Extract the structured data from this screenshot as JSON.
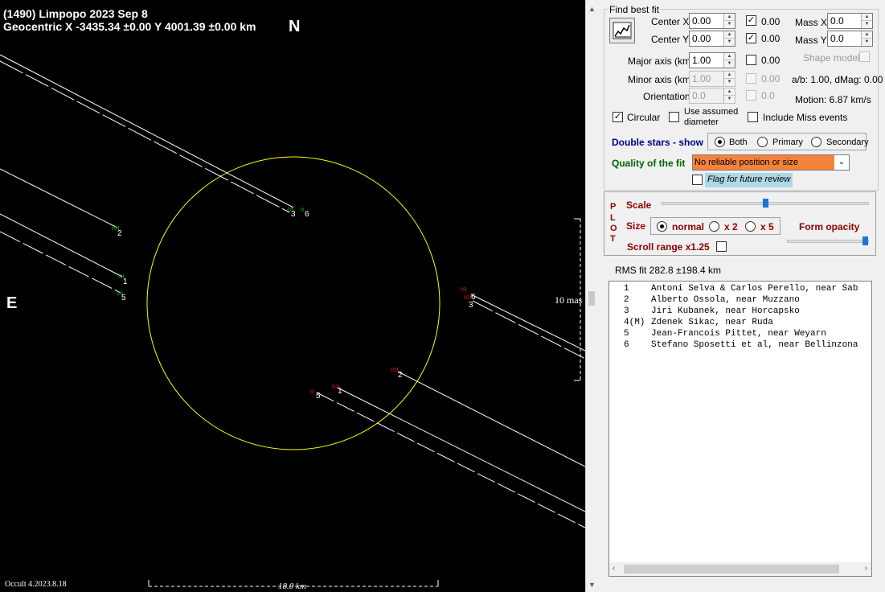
{
  "plot": {
    "title": "(1490) Limpopo  2023 Sep 8",
    "coords": "Geocentric X  -3435.34 ±0.00  Y 4001.39 ±0.00 km",
    "north": "N",
    "east": "E",
    "scale_mas": "10 mas",
    "scale_km": "18.0 km",
    "version": "Occult 4.2023.8.18",
    "chord_labels": [
      "2",
      "1",
      "5",
      "3",
      "6",
      "3",
      "6",
      "1",
      "5",
      "2"
    ]
  },
  "panel": {
    "find_best_fit": "Find best fit",
    "center_x_label": "Center X",
    "center_x_value": "0.00",
    "center_y_label": "Center Y",
    "center_y_value": "0.00",
    "center_x_unc": "0.00",
    "center_y_unc": "0.00",
    "mass_x_label": "Mass X",
    "mass_x_value": "0.0",
    "mass_y_label": "Mass Y",
    "mass_y_value": "0.0",
    "major_label": "Major axis (km)",
    "major_value": "1.00",
    "major_unc": "0.00",
    "minor_label": "Minor axis (km)",
    "minor_value": "1.00",
    "minor_unc": "0.00",
    "orient_label": "Orientation",
    "orient_value": "0.0",
    "orient_unc": "0.0",
    "shape_model": "Shape model",
    "ab_dmag": "a/b: 1.00, dMag: 0.00",
    "motion": "Motion: 6.87 km/s",
    "circular": "Circular",
    "use_assumed": "Use assumed",
    "diameter": "diameter",
    "include_miss": "Include Miss events",
    "double_stars": "Double stars - show",
    "both": "Both",
    "primary": "Primary",
    "secondary": "Secondary",
    "quality_label": "Quality of the fit",
    "quality_value": "No reliable position or size",
    "flag_review": "Flag for future review",
    "plot_letters": [
      "P",
      "L",
      "O",
      "T"
    ],
    "scale": "Scale",
    "size": "Size",
    "normal": "normal",
    "x2": "x 2",
    "x5": "x 5",
    "form_opacity": "Form opacity",
    "scroll_range": "Scroll range x1.25",
    "rms": "RMS fit 282.8 ±198.4 km"
  },
  "observers": [
    {
      "num": "1",
      "name": "Antoni Selva & Carlos Perello, near Sab"
    },
    {
      "num": "2",
      "name": "Alberto Ossola, near Muzzano"
    },
    {
      "num": "3",
      "name": "Jiri Kubanek, near Horcapsko"
    },
    {
      "num": "4(M)",
      "name": "Zdenek Sikac, near Ruda"
    },
    {
      "num": "5",
      "name": "Jean-Francois Pittet, near Weyarn"
    },
    {
      "num": "6",
      "name": "Stefano Sposetti et al, near Bellinzona"
    }
  ],
  "colors": {
    "outline": "#ffff00",
    "disappear": "#22cc22",
    "reappear": "#ff2020",
    "quality_bg": "#f5823b",
    "double_title": "#00008b",
    "quality_title": "#006400",
    "plot_title": "#8b0000"
  }
}
